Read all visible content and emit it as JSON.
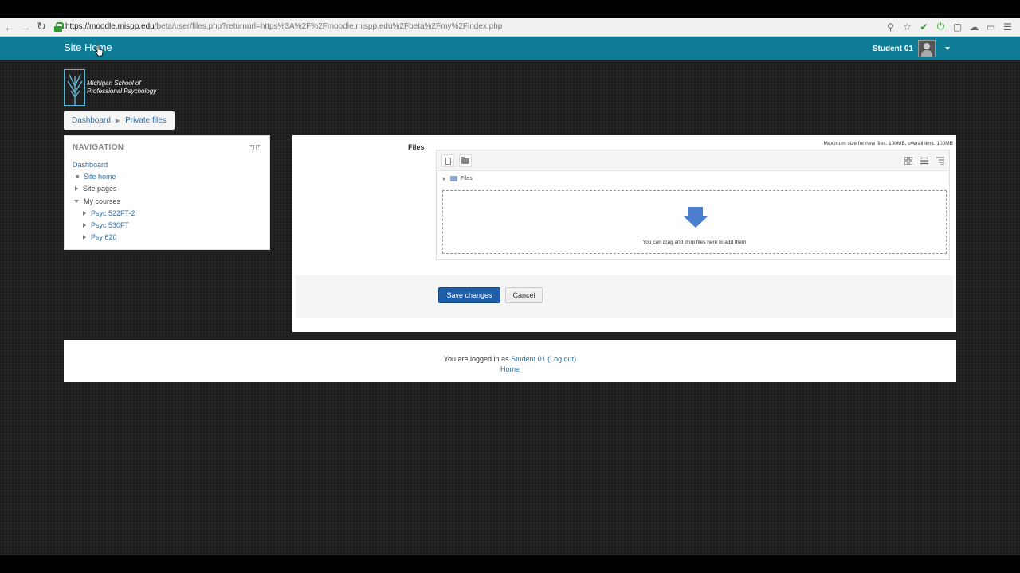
{
  "browser": {
    "url_host": "https://moodle.mispp.edu",
    "url_path": "/beta/user/files.php?returnurl=https%3A%2F%2Fmoodle.mispp.edu%2Fbeta%2Fmy%2Findex.php"
  },
  "navbar": {
    "brand": "Site Home",
    "user_name": "Student 01",
    "color": "#0f7c95"
  },
  "logo": {
    "line1": "Michigan School of",
    "line2": "Professional Psychology"
  },
  "breadcrumb": {
    "items": [
      "Dashboard",
      "Private files"
    ]
  },
  "navigation": {
    "title": "NAVIGATION",
    "dashboard": "Dashboard",
    "site_home": "Site home",
    "site_pages": "Site pages",
    "my_courses": "My courses",
    "courses": [
      "Psyc 522FT-2",
      "Psyc 530FT",
      "Psy 620"
    ]
  },
  "files": {
    "label": "Files",
    "max_size": "Maximum size for new files: 100MB, overall limit: 100MB",
    "path_label": "Files",
    "drop_text": "You can drag and drop files here to add them"
  },
  "form": {
    "save_label": "Save changes",
    "cancel_label": "Cancel"
  },
  "footer": {
    "logged_in_prefix": "You are logged in as",
    "user_link": "Student 01",
    "logout": "(Log out)",
    "home": "Home"
  }
}
